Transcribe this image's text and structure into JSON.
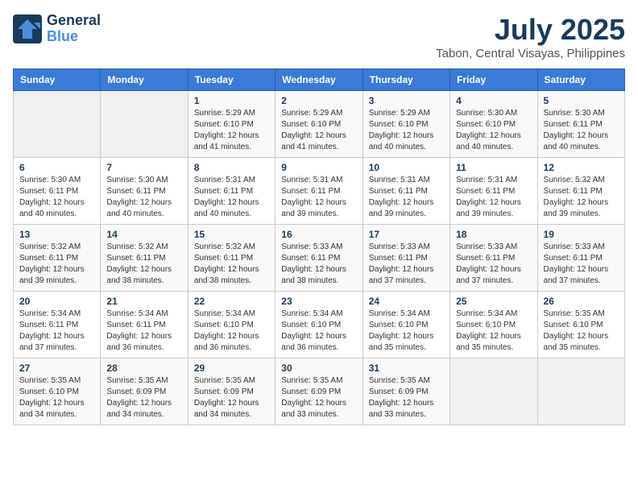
{
  "header": {
    "logo_line1": "General",
    "logo_line2": "Blue",
    "title": "July 2025",
    "subtitle": "Tabon, Central Visayas, Philippines"
  },
  "weekdays": [
    "Sunday",
    "Monday",
    "Tuesday",
    "Wednesday",
    "Thursday",
    "Friday",
    "Saturday"
  ],
  "weeks": [
    [
      {
        "day": "",
        "info": ""
      },
      {
        "day": "",
        "info": ""
      },
      {
        "day": "1",
        "info": "Sunrise: 5:29 AM\nSunset: 6:10 PM\nDaylight: 12 hours and 41 minutes."
      },
      {
        "day": "2",
        "info": "Sunrise: 5:29 AM\nSunset: 6:10 PM\nDaylight: 12 hours and 41 minutes."
      },
      {
        "day": "3",
        "info": "Sunrise: 5:29 AM\nSunset: 6:10 PM\nDaylight: 12 hours and 40 minutes."
      },
      {
        "day": "4",
        "info": "Sunrise: 5:30 AM\nSunset: 6:10 PM\nDaylight: 12 hours and 40 minutes."
      },
      {
        "day": "5",
        "info": "Sunrise: 5:30 AM\nSunset: 6:11 PM\nDaylight: 12 hours and 40 minutes."
      }
    ],
    [
      {
        "day": "6",
        "info": "Sunrise: 5:30 AM\nSunset: 6:11 PM\nDaylight: 12 hours and 40 minutes."
      },
      {
        "day": "7",
        "info": "Sunrise: 5:30 AM\nSunset: 6:11 PM\nDaylight: 12 hours and 40 minutes."
      },
      {
        "day": "8",
        "info": "Sunrise: 5:31 AM\nSunset: 6:11 PM\nDaylight: 12 hours and 40 minutes."
      },
      {
        "day": "9",
        "info": "Sunrise: 5:31 AM\nSunset: 6:11 PM\nDaylight: 12 hours and 39 minutes."
      },
      {
        "day": "10",
        "info": "Sunrise: 5:31 AM\nSunset: 6:11 PM\nDaylight: 12 hours and 39 minutes."
      },
      {
        "day": "11",
        "info": "Sunrise: 5:31 AM\nSunset: 6:11 PM\nDaylight: 12 hours and 39 minutes."
      },
      {
        "day": "12",
        "info": "Sunrise: 5:32 AM\nSunset: 6:11 PM\nDaylight: 12 hours and 39 minutes."
      }
    ],
    [
      {
        "day": "13",
        "info": "Sunrise: 5:32 AM\nSunset: 6:11 PM\nDaylight: 12 hours and 39 minutes."
      },
      {
        "day": "14",
        "info": "Sunrise: 5:32 AM\nSunset: 6:11 PM\nDaylight: 12 hours and 38 minutes."
      },
      {
        "day": "15",
        "info": "Sunrise: 5:32 AM\nSunset: 6:11 PM\nDaylight: 12 hours and 38 minutes."
      },
      {
        "day": "16",
        "info": "Sunrise: 5:33 AM\nSunset: 6:11 PM\nDaylight: 12 hours and 38 minutes."
      },
      {
        "day": "17",
        "info": "Sunrise: 5:33 AM\nSunset: 6:11 PM\nDaylight: 12 hours and 37 minutes."
      },
      {
        "day": "18",
        "info": "Sunrise: 5:33 AM\nSunset: 6:11 PM\nDaylight: 12 hours and 37 minutes."
      },
      {
        "day": "19",
        "info": "Sunrise: 5:33 AM\nSunset: 6:11 PM\nDaylight: 12 hours and 37 minutes."
      }
    ],
    [
      {
        "day": "20",
        "info": "Sunrise: 5:34 AM\nSunset: 6:11 PM\nDaylight: 12 hours and 37 minutes."
      },
      {
        "day": "21",
        "info": "Sunrise: 5:34 AM\nSunset: 6:11 PM\nDaylight: 12 hours and 36 minutes."
      },
      {
        "day": "22",
        "info": "Sunrise: 5:34 AM\nSunset: 6:10 PM\nDaylight: 12 hours and 36 minutes."
      },
      {
        "day": "23",
        "info": "Sunrise: 5:34 AM\nSunset: 6:10 PM\nDaylight: 12 hours and 36 minutes."
      },
      {
        "day": "24",
        "info": "Sunrise: 5:34 AM\nSunset: 6:10 PM\nDaylight: 12 hours and 35 minutes."
      },
      {
        "day": "25",
        "info": "Sunrise: 5:34 AM\nSunset: 6:10 PM\nDaylight: 12 hours and 35 minutes."
      },
      {
        "day": "26",
        "info": "Sunrise: 5:35 AM\nSunset: 6:10 PM\nDaylight: 12 hours and 35 minutes."
      }
    ],
    [
      {
        "day": "27",
        "info": "Sunrise: 5:35 AM\nSunset: 6:10 PM\nDaylight: 12 hours and 34 minutes."
      },
      {
        "day": "28",
        "info": "Sunrise: 5:35 AM\nSunset: 6:09 PM\nDaylight: 12 hours and 34 minutes."
      },
      {
        "day": "29",
        "info": "Sunrise: 5:35 AM\nSunset: 6:09 PM\nDaylight: 12 hours and 34 minutes."
      },
      {
        "day": "30",
        "info": "Sunrise: 5:35 AM\nSunset: 6:09 PM\nDaylight: 12 hours and 33 minutes."
      },
      {
        "day": "31",
        "info": "Sunrise: 5:35 AM\nSunset: 6:09 PM\nDaylight: 12 hours and 33 minutes."
      },
      {
        "day": "",
        "info": ""
      },
      {
        "day": "",
        "info": ""
      }
    ]
  ]
}
